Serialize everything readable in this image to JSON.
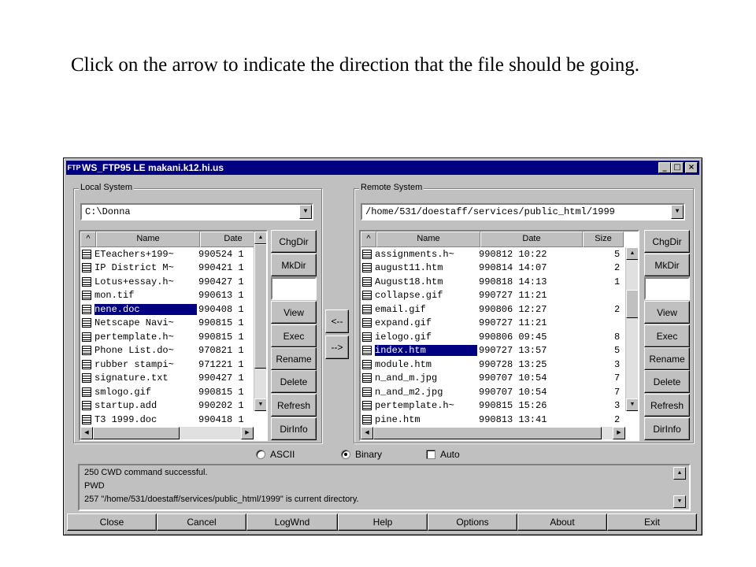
{
  "caption": "Click on the arrow to indicate the direction that the file should be going.",
  "window": {
    "title": "WS_FTP95 LE makani.k12.hi.us",
    "title_icon": "FTP",
    "minimize_glyph": "_",
    "maximize_glyph": "□",
    "close_glyph": "×"
  },
  "local": {
    "label": "Local System",
    "path": "C:\\Donna",
    "columns": [
      "^",
      "Name",
      "Date"
    ],
    "files": [
      {
        "name": "ETeachers+199~",
        "date": "990524 1",
        "selected": false
      },
      {
        "name": "IP District M~",
        "date": "990421 1",
        "selected": false
      },
      {
        "name": "Lotus+essay.h~",
        "date": "990427 1",
        "selected": false
      },
      {
        "name": "mon.tif",
        "date": "990613 1",
        "selected": false
      },
      {
        "name": "nene.doc",
        "date": "990408 1",
        "selected": true
      },
      {
        "name": "Netscape Navi~",
        "date": "990815 1",
        "selected": false
      },
      {
        "name": "pertemplate.h~",
        "date": "990815 1",
        "selected": false
      },
      {
        "name": "Phone List.do~",
        "date": "970821 1",
        "selected": false
      },
      {
        "name": "rubber stampi~",
        "date": "971221 1",
        "selected": false
      },
      {
        "name": "signature.txt",
        "date": "990427 1",
        "selected": false
      },
      {
        "name": "smlogo.gif",
        "date": "990815 1",
        "selected": false
      },
      {
        "name": "startup.add",
        "date": "990202 1",
        "selected": false
      },
      {
        "name": "T3 1999.doc",
        "date": "990418 1",
        "selected": false
      }
    ],
    "buttons": [
      "ChgDir",
      "MkDir",
      "",
      "View",
      "Exec",
      "Rename",
      "Delete",
      "Refresh",
      "DirInfo"
    ]
  },
  "transfer": {
    "left_arrow": "<--",
    "right_arrow": "-->"
  },
  "remote": {
    "label": "Remote System",
    "path": "/home/531/doestaff/services/public_html/1999",
    "columns": [
      "^",
      "Name",
      "Date",
      "Size"
    ],
    "files": [
      {
        "name": "assignments.h~",
        "date": "990812 10:22",
        "size": "5",
        "selected": false
      },
      {
        "name": "august11.htm",
        "date": "990814 14:07",
        "size": "2",
        "selected": false
      },
      {
        "name": "August18.htm",
        "date": "990818 14:13",
        "size": "1",
        "selected": false
      },
      {
        "name": "collapse.gif",
        "date": "990727 11:21",
        "size": "",
        "selected": false
      },
      {
        "name": "email.gif",
        "date": "990806 12:27",
        "size": "2",
        "selected": false
      },
      {
        "name": "expand.gif",
        "date": "990727 11:21",
        "size": "",
        "selected": false
      },
      {
        "name": "ielogo.gif",
        "date": "990806 09:45",
        "size": "8",
        "selected": false
      },
      {
        "name": "index.htm",
        "date": "990727 13:57",
        "size": "5",
        "selected": true
      },
      {
        "name": "module.htm",
        "date": "990728 13:25",
        "size": "3",
        "selected": false
      },
      {
        "name": "n_and_m.jpg",
        "date": "990707 10:54",
        "size": "7",
        "selected": false
      },
      {
        "name": "n_and_m2.jpg",
        "date": "990707 10:54",
        "size": "7",
        "selected": false
      },
      {
        "name": "pertemplate.h~",
        "date": "990815 15:26",
        "size": "3",
        "selected": false
      },
      {
        "name": "pine.htm",
        "date": "990813 13:41",
        "size": "2",
        "selected": false
      }
    ],
    "buttons": [
      "ChgDir",
      "MkDir",
      "",
      "View",
      "Exec",
      "Rename",
      "Delete",
      "Refresh",
      "DirInfo"
    ]
  },
  "mode": {
    "ascii": "ASCII",
    "binary": "Binary",
    "auto": "Auto",
    "selected": "Binary"
  },
  "log": [
    "250 CWD command successful.",
    "PWD",
    "257 \"/home/531/doestaff/services/public_html/1999\" is current directory."
  ],
  "bottom_buttons": [
    "Close",
    "Cancel",
    "LogWnd",
    "Help",
    "Options",
    "About",
    "Exit"
  ],
  "scroll_glyphs": {
    "up": "▲",
    "down": "▼",
    "left": "◀",
    "right": "▶"
  }
}
